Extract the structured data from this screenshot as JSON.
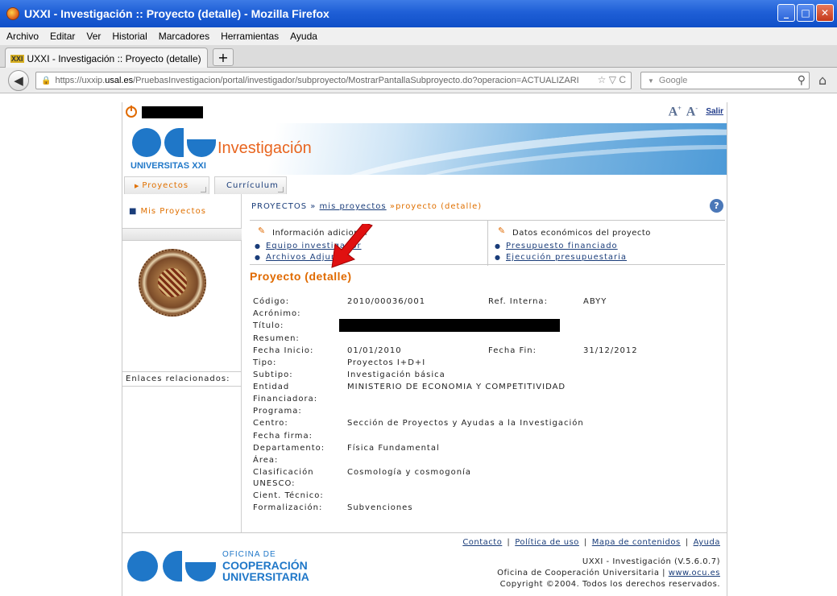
{
  "window": {
    "title": "UXXI - Investigación :: Proyecto (detalle) - Mozilla Firefox",
    "buttons": {
      "minimize": "_",
      "maximize": "□",
      "close": "✕"
    }
  },
  "menubar": [
    "Archivo",
    "Editar",
    "Ver",
    "Historial",
    "Marcadores",
    "Herramientas",
    "Ayuda"
  ],
  "browser_tab": {
    "favicon": "XXI",
    "label": "UXXI - Investigación :: Proyecto (detalle)",
    "new_tab": "+"
  },
  "navbar": {
    "url_prefix": "https://uxxip.",
    "url_host": "usal.es",
    "url_path": "/PruebasInvestigacion/portal/investigador/subproyecto/MostrarPantallaSubproyecto.do?operacion=ACTUALIZARI",
    "search_placeholder": "Google"
  },
  "page": {
    "salir": "Salir",
    "banner": {
      "university": "UNIVERSITAS XXI",
      "title": "Investigación"
    },
    "tabs": [
      "Proyectos",
      "Currículum"
    ],
    "sidebar": {
      "item": "Mis Proyectos",
      "enlaces": "Enlaces relacionados:"
    },
    "breadcrumb": {
      "root": "PROYECTOS",
      "sep": "»",
      "link": "mis proyectos",
      "current": "proyecto (detalle)"
    },
    "info_left": {
      "heading": "Información adicional",
      "links": [
        "Equipo investigador",
        "Archivos Adjuntos"
      ]
    },
    "info_right": {
      "heading": "Datos económicos del proyecto",
      "links": [
        "Presupuesto financiado",
        "Ejecución presupuestaria"
      ]
    },
    "title": "Proyecto (detalle)",
    "fields": {
      "codigo_label": "Código:",
      "codigo": "2010/00036/001",
      "ref_label": "Ref. Interna:",
      "ref": "ABYY",
      "acronimo_label": "Acrónimo:",
      "titulo_label": "Título:",
      "resumen_label": "Resumen:",
      "fecha_inicio_label": "Fecha Inicio:",
      "fecha_inicio": "01/01/2010",
      "fecha_fin_label": "Fecha Fin:",
      "fecha_fin": "31/12/2012",
      "tipo_label": "Tipo:",
      "tipo": "Proyectos I+D+I",
      "subtipo_label": "Subtipo:",
      "subtipo": "Investigación básica",
      "entidad_label": "Entidad",
      "entidad": "MINISTERIO DE ECONOMIA Y COMPETITIVIDAD",
      "financiadora_label": "Financiadora:",
      "programa_label": "Programa:",
      "centro_label": "Centro:",
      "centro": "Sección de Proyectos y Ayudas a la Investigación",
      "fecha_firma_label": "Fecha firma:",
      "departamento_label": "Departamento:",
      "departamento": "Física Fundamental",
      "area_label": "Área:",
      "clasificacion_label": "Clasificación",
      "clasificacion": "Cosmología y cosmogonía",
      "unesco_label": "UNESCO:",
      "cient_label": "Cient. Técnico:",
      "formalizacion_label": "Formalización:",
      "formalizacion": "Subvenciones"
    },
    "footer": {
      "links": [
        "Contacto",
        "Política de uso",
        "Mapa de contenidos",
        "Ayuda"
      ],
      "version": "UXXI - Investigación (V.5.6.0.7)",
      "oficina": "Oficina de Cooperación Universitaria |",
      "site": "www.ocu.es",
      "copyright": "Copyright ©2004. Todos los derechos reservados.",
      "logo_lines": [
        "OFICINA DE",
        "COOPERACIÓN",
        "UNIVERSITARIA"
      ]
    }
  },
  "colors": {
    "accent_orange": "#e06a00",
    "link_blue": "#1a3d7a",
    "ocu_blue": "#1f77c8",
    "arrow_red": "#e01010"
  }
}
